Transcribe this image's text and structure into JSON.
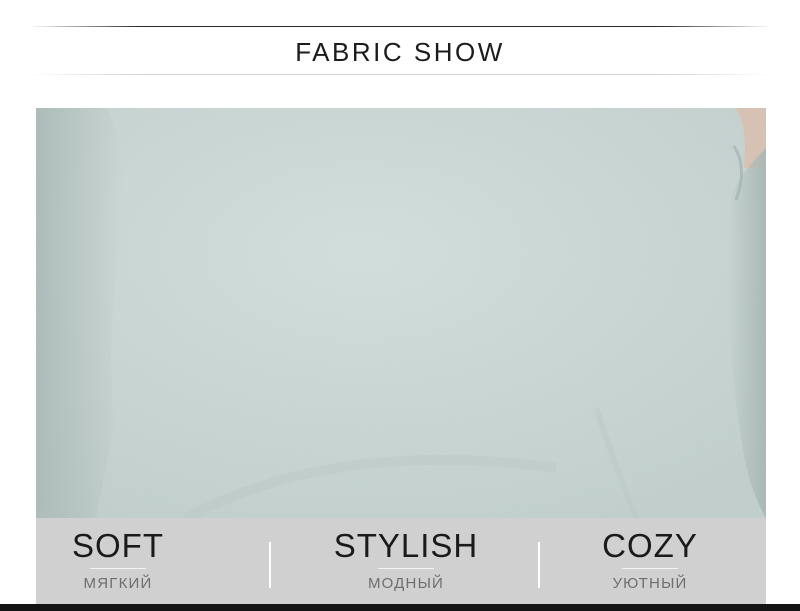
{
  "header": {
    "title": "FABRIC SHOW"
  },
  "features": [
    {
      "en": "SOFT",
      "ru": "МЯГКИЙ"
    },
    {
      "en": "STYLISH",
      "ru": "МОДНЫЙ"
    },
    {
      "en": "COZY",
      "ru": "УЮТНЫЙ"
    }
  ],
  "colors": {
    "fabric": "#c9d7d5",
    "strip": "#d0d0d0",
    "bar": "#141414"
  }
}
